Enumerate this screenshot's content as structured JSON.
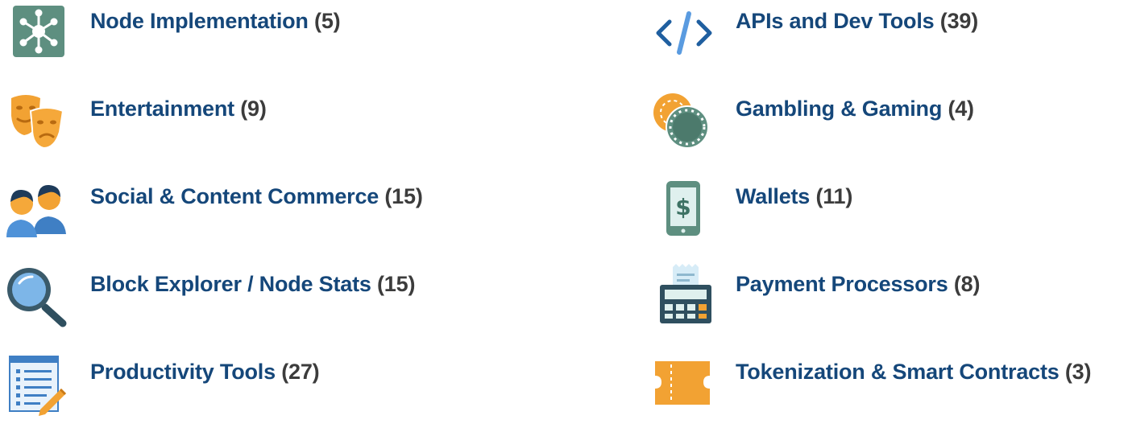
{
  "categories": [
    {
      "label": "Node Implementation",
      "count": "(5)",
      "icon": "network-node-icon"
    },
    {
      "label": "APIs and Dev Tools",
      "count": "(39)",
      "icon": "code-brackets-icon"
    },
    {
      "label": "Entertainment",
      "count": "(9)",
      "icon": "theater-masks-icon"
    },
    {
      "label": "Gambling & Gaming",
      "count": "(4)",
      "icon": "casino-chips-icon"
    },
    {
      "label": "Social & Content Commerce",
      "count": "(15)",
      "icon": "people-icon"
    },
    {
      "label": "Wallets",
      "count": "(11)",
      "icon": "mobile-wallet-icon"
    },
    {
      "label": "Block Explorer / Node Stats",
      "count": "(15)",
      "icon": "magnifier-icon"
    },
    {
      "label": "Payment Processors",
      "count": "(8)",
      "icon": "payment-terminal-icon"
    },
    {
      "label": "Productivity Tools",
      "count": "(27)",
      "icon": "checklist-pencil-icon"
    },
    {
      "label": "Tokenization & Smart Contracts",
      "count": "(3)",
      "icon": "ticket-icon"
    }
  ],
  "colors": {
    "label": "#15477a",
    "count": "#3c3c3c",
    "teal": "#5b8a7c",
    "orange": "#f0a030",
    "blue": "#3f7fc4"
  }
}
